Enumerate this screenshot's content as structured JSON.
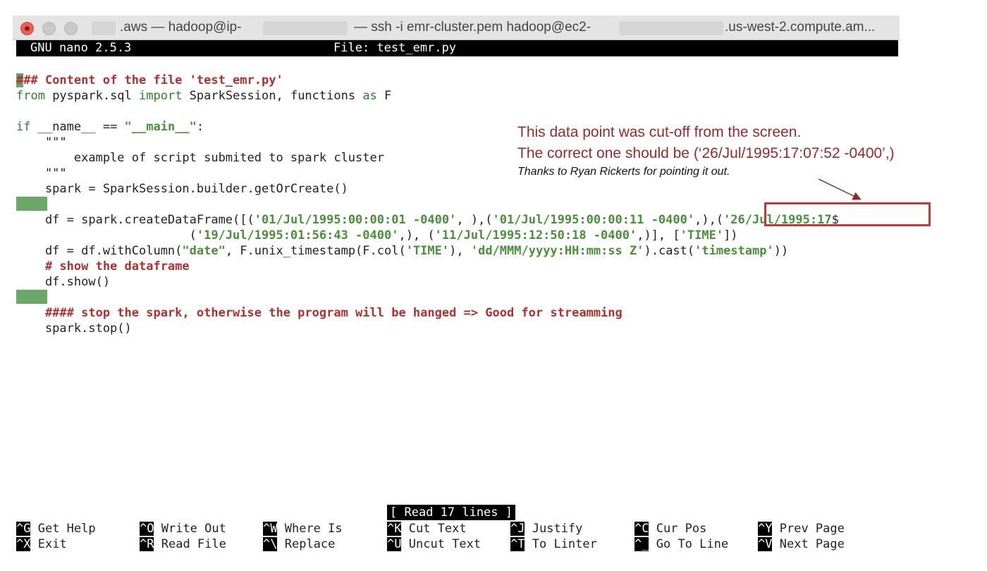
{
  "window": {
    "title_prefix": ".aws — hadoop@ip-",
    "title_middle": "— ssh -i emr-cluster.pem hadoop@ec2-",
    "title_suffix": ".us-west-2.compute.am..."
  },
  "nano": {
    "version": "GNU nano 2.5.3",
    "file": "File: test_emr.py",
    "status": "[ Read 17 lines ]"
  },
  "code": {
    "l1_cursor": "#",
    "l1_rest": "## Content of the file 'test_emr.py'",
    "l2_from": "from",
    "l2_a": " pyspark.sql ",
    "l2_import": "import",
    "l2_b": " SparkSession, functions ",
    "l2_as": "as",
    "l2_c": " F",
    "l4_if": "if",
    "l4_a": " __name__ == ",
    "l4_str": "\"__main__\"",
    "l4_b": ":",
    "l5": "    \"\"\"",
    "l6": "        example of script submited to spark cluster",
    "l7": "    \"\"\"",
    "l8": "    spark = SparkSession.builder.getOrCreate()",
    "l10_a": "    df = spark.createDataFrame([(",
    "l10_s1": "'01/Jul/1995:00:00:01 -0400'",
    "l10_b": ", ),(",
    "l10_s2": "'01/Jul/1995:00:00:11 -0400'",
    "l10_c": ",),(",
    "l10_s3": "'26/Jul/1995:17",
    "l10_d": "$",
    "l11_a": "                        (",
    "l11_s1": "'19/Jul/1995:01:56:43 -0400'",
    "l11_b": ",), (",
    "l11_s2": "'11/Jul/1995:12:50:18 -0400'",
    "l11_c": ",)], [",
    "l11_s3": "'TIME'",
    "l11_d": "])",
    "l12_a": "    df = df.withColumn(",
    "l12_s1": "\"date\"",
    "l12_b": ", F.unix_timestamp(F.col(",
    "l12_s2": "'TIME'",
    "l12_c": "), ",
    "l12_s3": "'dd/MMM/yyyy:HH:mm:ss Z'",
    "l12_d": ").cast(",
    "l12_s4": "'timestamp'",
    "l12_e": "))",
    "l13": "    # show the dataframe",
    "l14": "    df.show()",
    "l16": "    #### stop the spark, otherwise the program will be hanged => Good for streamming",
    "l17": "    spark.stop()"
  },
  "annotation": {
    "line1": "This data point was cut-off from the screen.",
    "line2": "The correct one should be (‘26/Jul/1995:17:07:52 -0400’,)",
    "line3": "Thanks to Ryan Rickerts for pointing it out.",
    "color": "#9a2a2a"
  },
  "shortcuts": [
    {
      "key": "^G",
      "label": "Get Help"
    },
    {
      "key": "^O",
      "label": "Write Out"
    },
    {
      "key": "^W",
      "label": "Where Is"
    },
    {
      "key": "^K",
      "label": "Cut Text"
    },
    {
      "key": "^J",
      "label": "Justify"
    },
    {
      "key": "^C",
      "label": "Cur Pos"
    },
    {
      "key": "^Y",
      "label": "Prev Page"
    },
    {
      "key": "^X",
      "label": "Exit"
    },
    {
      "key": "^R",
      "label": "Read File"
    },
    {
      "key": "^\\",
      "label": "Replace"
    },
    {
      "key": "^U",
      "label": "Uncut Text"
    },
    {
      "key": "^T",
      "label": "To Linter"
    },
    {
      "key": "^_",
      "label": "Go To Line"
    },
    {
      "key": "^V",
      "label": "Next Page"
    }
  ]
}
